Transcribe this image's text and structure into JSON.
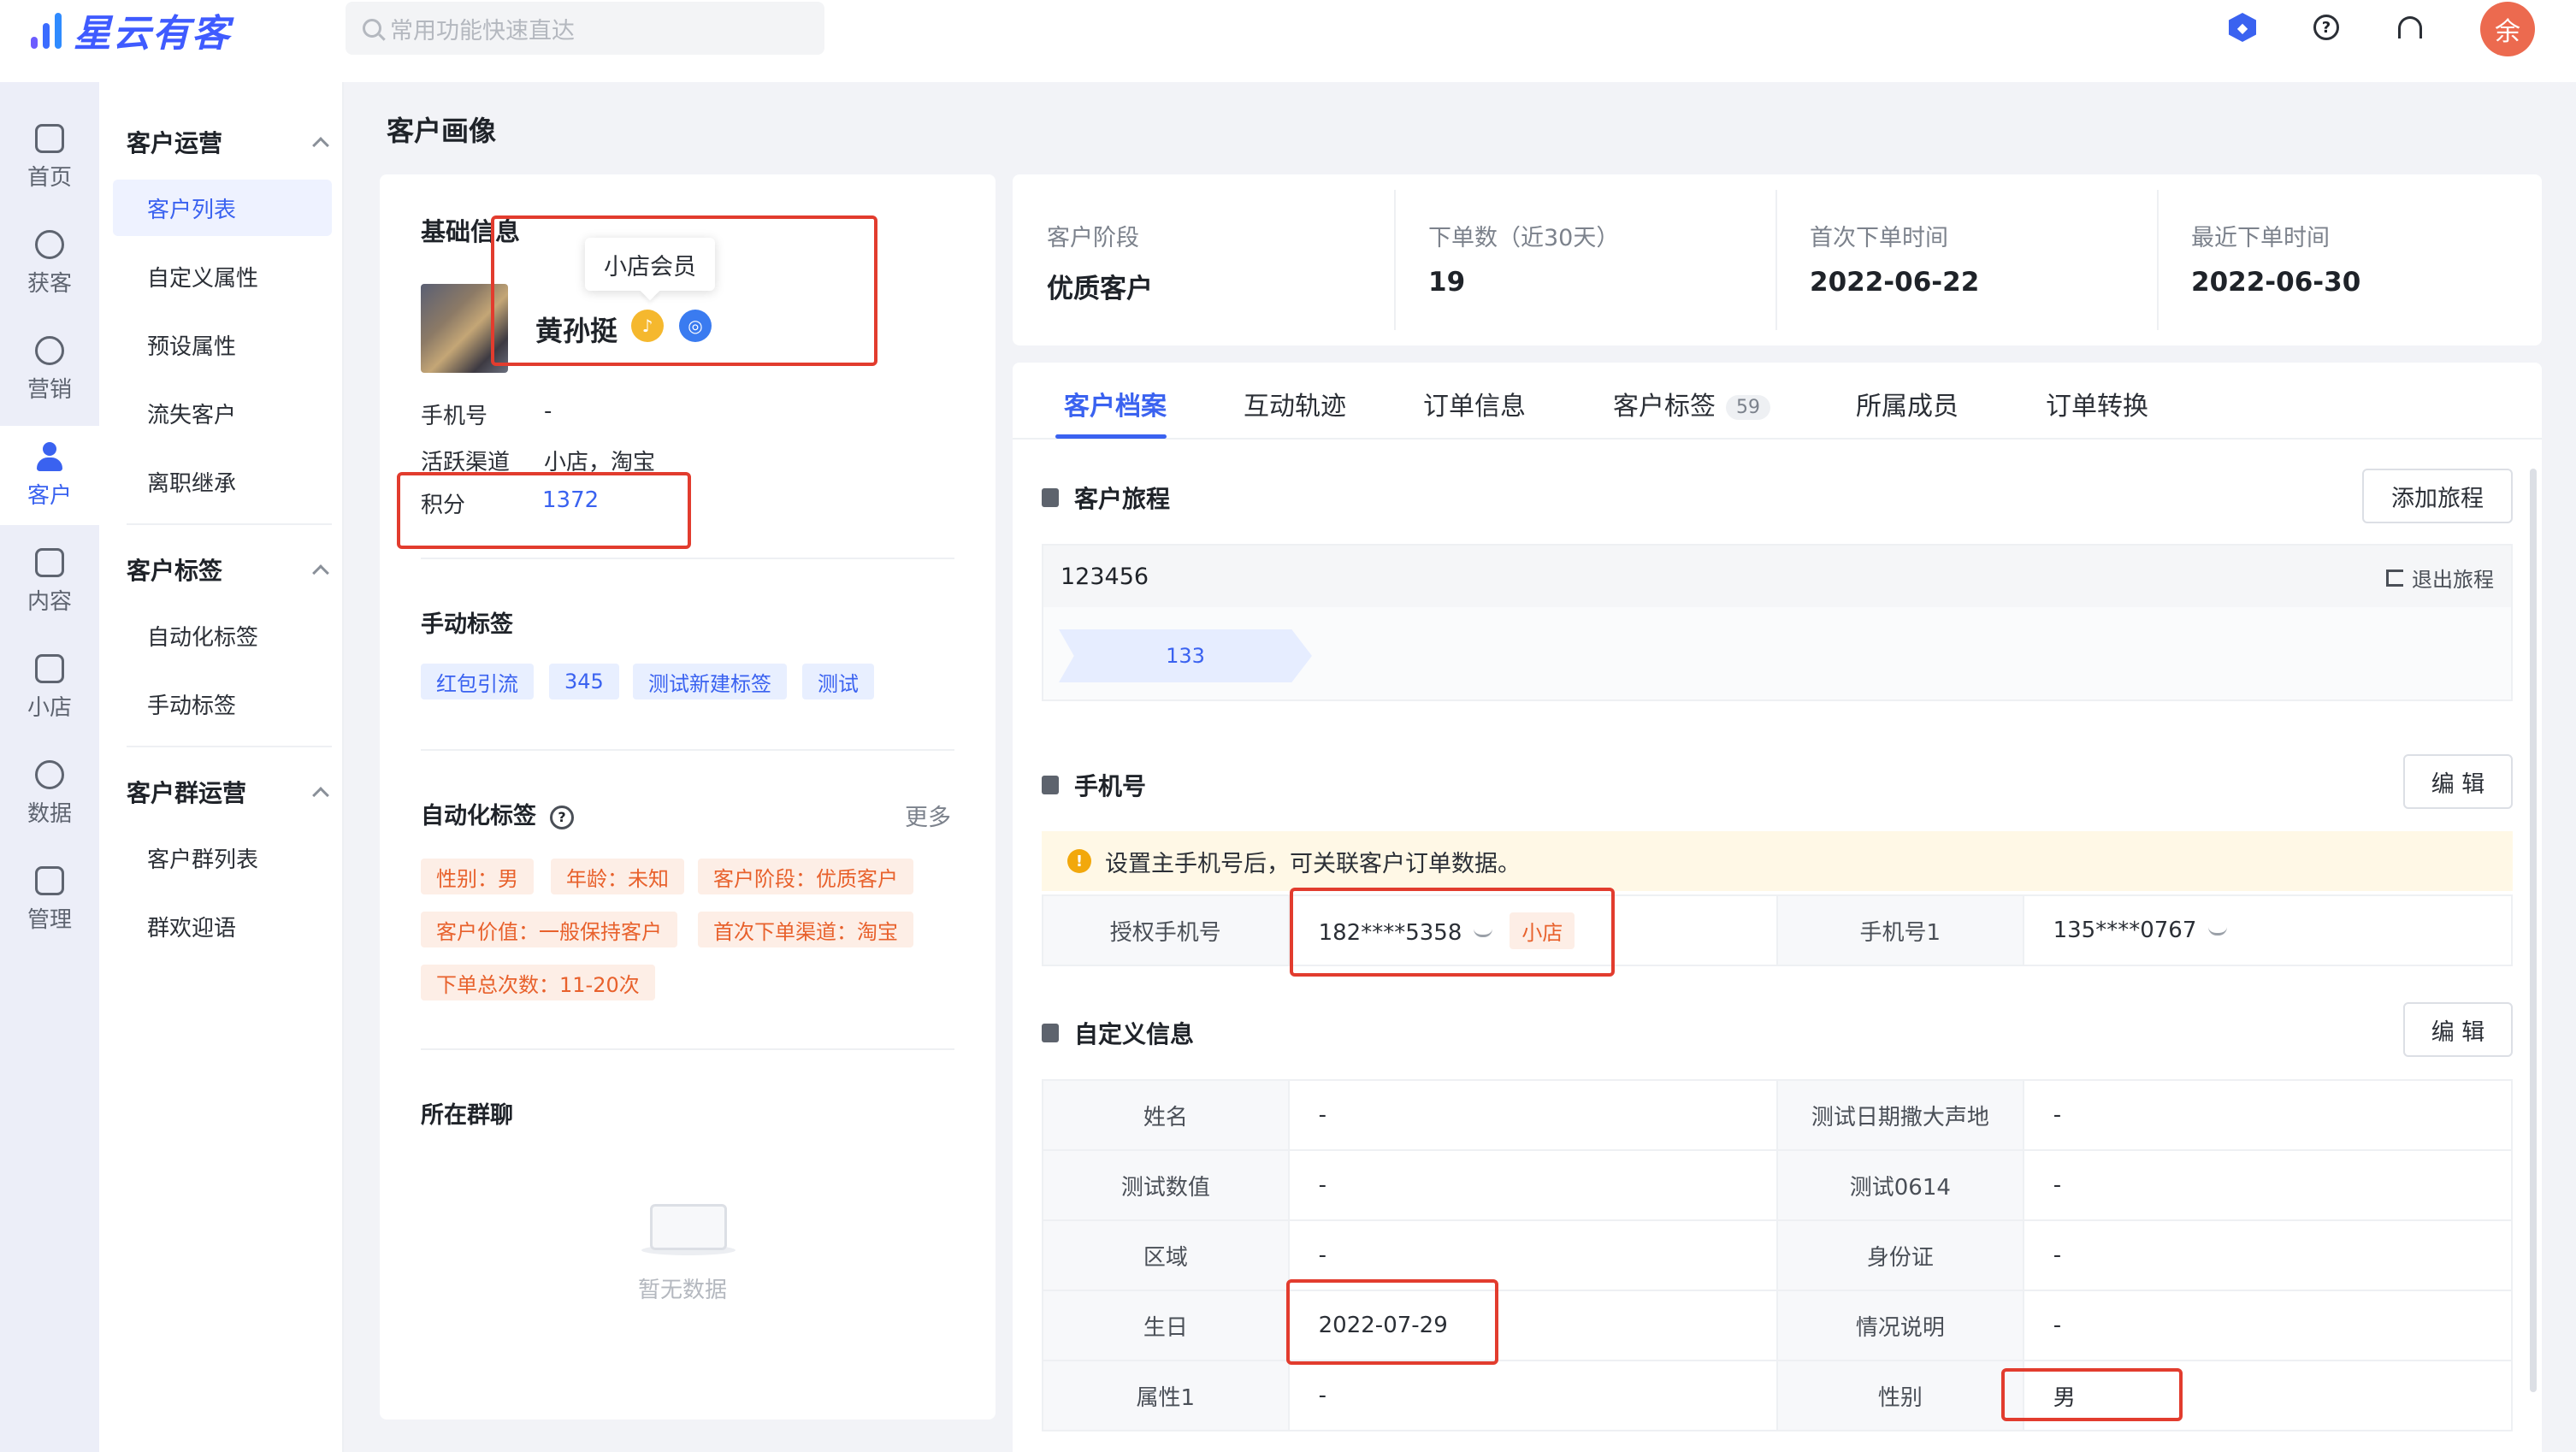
{
  "app": {
    "logo_text": "星云有客"
  },
  "search": {
    "placeholder": "常用功能快速直达"
  },
  "user": {
    "avatar_initial": "余"
  },
  "rail": [
    {
      "label": "首页",
      "icon": "home-icon"
    },
    {
      "label": "获客",
      "icon": "add-user-icon"
    },
    {
      "label": "营销",
      "icon": "bulb-icon"
    },
    {
      "label": "客户",
      "icon": "user-icon",
      "active": true
    },
    {
      "label": "内容",
      "icon": "folder-icon"
    },
    {
      "label": "小店",
      "icon": "shop-icon"
    },
    {
      "label": "数据",
      "icon": "pie-icon"
    },
    {
      "label": "管理",
      "icon": "grid-icon"
    }
  ],
  "subnav": {
    "groups": [
      "客户运营",
      "客户标签",
      "客户群运营"
    ],
    "items": [
      "客户列表",
      "自定义属性",
      "预设属性",
      "流失客户",
      "离职继承",
      "自动化标签",
      "手动标签",
      "客户群列表",
      "群欢迎语"
    ]
  },
  "page": {
    "title": "客户画像"
  },
  "profile": {
    "section_title": "基础信息",
    "tooltip": "小店会员",
    "name": "黄孙挺",
    "fields": [
      {
        "label": "手机号",
        "value": "-"
      },
      {
        "label": "活跃渠道",
        "value": "小店，淘宝"
      },
      {
        "label": "积分",
        "value": "1372"
      }
    ],
    "manual_tags_title": "手动标签",
    "manual_tags": [
      "红包引流",
      "345",
      "测试新建标签",
      "测试"
    ],
    "auto_tags_title": "自动化标签",
    "auto_tags_more": "更多",
    "auto_tags": [
      "性别：男",
      "年龄：未知",
      "客户阶段：优质客户",
      "客户价值：一般保持客户",
      "首次下单渠道：淘宝",
      "下单总次数：11-20次"
    ],
    "groups_title": "所在群聊",
    "empty_text": "暂无数据"
  },
  "stats": [
    {
      "label": "客户阶段",
      "value": "优质客户"
    },
    {
      "label": "下单数（近30天）",
      "value": "19"
    },
    {
      "label": "首次下单时间",
      "value": "2022-06-22"
    },
    {
      "label": "最近下单时间",
      "value": "2022-06-30"
    }
  ],
  "tabs": [
    {
      "label": "客户档案",
      "active": true
    },
    {
      "label": "互动轨迹"
    },
    {
      "label": "订单信息"
    },
    {
      "label": "客户标签",
      "count": "59"
    },
    {
      "label": "所属成员"
    },
    {
      "label": "订单转换"
    }
  ],
  "journey": {
    "title": "客户旅程",
    "add_button": "添加旅程",
    "name": "123456",
    "exit_label": "退出旅程",
    "step": "133"
  },
  "phone": {
    "title": "手机号",
    "edit_button": "编 辑",
    "notice": "设置主手机号后，可关联客户订单数据。",
    "rows": [
      {
        "k1": "授权手机号",
        "v1": "182****5358",
        "v1_tag": "小店",
        "k2": "手机号1",
        "v2": "135****0767"
      }
    ]
  },
  "custom": {
    "title": "自定义信息",
    "edit_button": "编 辑",
    "rows": [
      {
        "k1": "姓名",
        "v1": "-",
        "k2": "测试日期撒大声地",
        "v2": "-"
      },
      {
        "k1": "测试数值",
        "v1": "-",
        "k2": "测试0614",
        "v2": "-"
      },
      {
        "k1": "区域",
        "v1": "-",
        "k2": "身份证",
        "v2": "-"
      },
      {
        "k1": "生日",
        "v1": "2022-07-29",
        "k2": "情况说明",
        "v2": "-"
      },
      {
        "k1": "属性1",
        "v1": "-",
        "k2": "性别",
        "v2": "男"
      }
    ]
  },
  "colors": {
    "accent": "#3a62f0",
    "annotation": "#e23c2e",
    "tag_orange": "#e8612c"
  }
}
